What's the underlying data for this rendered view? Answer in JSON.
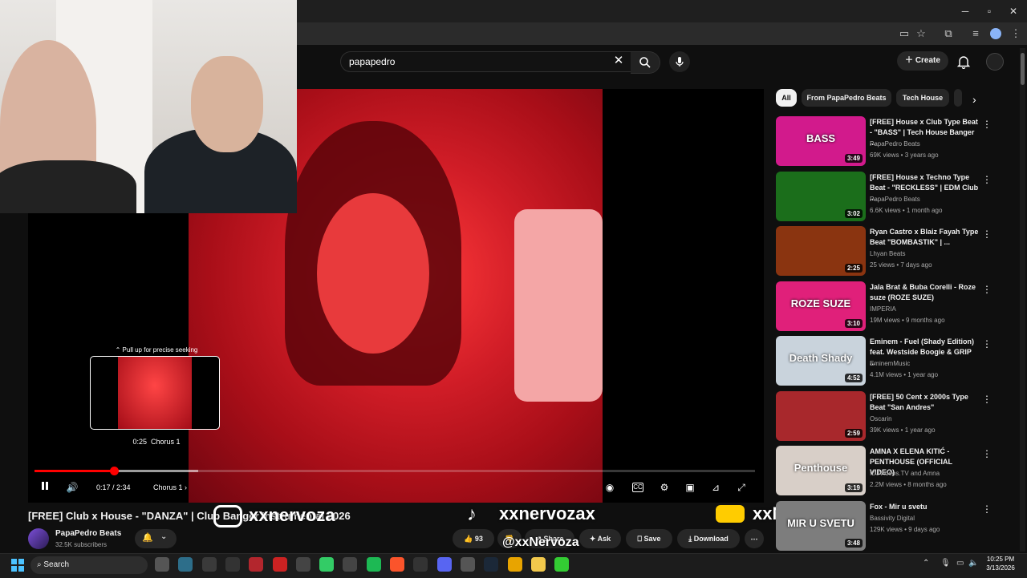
{
  "browser": {
    "minimize": "─",
    "maximize": "▫",
    "close": "✕"
  },
  "youtube": {
    "search": {
      "query": "papapedro"
    },
    "create_label": "Create"
  },
  "player": {
    "hint": "Pull up for precise seeking",
    "preview_time": "0:25",
    "preview_chapter": "Chorus 1",
    "time": "0:17 / 2:34",
    "chapter": "Chorus 1",
    "progress_fraction": 0.11
  },
  "video": {
    "title": "[FREE] Club x House - \"DANZA\" | Club Banger Instrumental 2026",
    "channel": "PapaPedro Beats",
    "subscribers": "32.5K subscribers",
    "likes": "93",
    "share_label": "Share",
    "ask_label": "Ask",
    "save_label": "Save",
    "download_label": "Download"
  },
  "overlays": {
    "instagram": "xxnervoza",
    "tiktok": "xxnervozax",
    "youtube": "xxNervozax",
    "handle": "@xxNervoza"
  },
  "chips": [
    "All",
    "From PapaPedro Beats",
    "Tech House"
  ],
  "recommendations": [
    {
      "title": "[FREE] House x Club Type Beat - \"BASS\" | Tech House Banger ...",
      "channel": "PapaPedro Beats",
      "meta": "69K views • 3 years ago",
      "duration": "3:49",
      "thumb_text": "BASS",
      "color": "#d21a8c"
    },
    {
      "title": "[FREE] House x Techno Type Beat - \"RECKLESS\" | EDM Club ...",
      "channel": "PapaPedro Beats",
      "meta": "6.6K views • 1 month ago",
      "duration": "3:02",
      "thumb_text": "",
      "color": "#1b6e1b"
    },
    {
      "title": "Ryan Castro x Blaiz Fayah Type Beat \"BOMBASTIK\" | ...",
      "channel": "Lhyan Beats",
      "meta": "25 views • 7 days ago",
      "duration": "2:25",
      "thumb_text": "",
      "color": "#8a3410"
    },
    {
      "title": "Jala Brat & Buba Corelli - Roze suze (ROZE SUZE)",
      "channel": "IMPERIA",
      "meta": "19M views • 9 months ago",
      "duration": "3:10",
      "thumb_text": "ROZE SUZE",
      "color": "#e0207a"
    },
    {
      "title": "Eminem - Fuel (Shady Edition) feat. Westside Boogie & GRIP ...",
      "channel": "EminemMusic",
      "meta": "4.1M views • 1 year ago",
      "duration": "4:52",
      "thumb_text": "Death Shady",
      "color": "#c9d3dc"
    },
    {
      "title": "[FREE] 50 Cent x 2000s Type Beat \"San Andres\"",
      "channel": "Oscarin",
      "meta": "39K views • 1 year ago",
      "duration": "2:59",
      "thumb_text": "",
      "color": "#a8282c"
    },
    {
      "title": "AMNA X ELENA KITIĆ - PENTHOUSE (OFFICIAL VIDEO)",
      "channel": "IDJVideos.TV and Amna",
      "meta": "2.2M views • 8 months ago",
      "duration": "3:19",
      "thumb_text": "Penthouse",
      "color": "#d8cfc8"
    },
    {
      "title": "Fox - Mir u svetu",
      "channel": "Bassivity Digital",
      "meta": "129K views • 9 days ago",
      "duration": "3:48",
      "thumb_text": "MIR U SVETU",
      "color": "#7d7d7d"
    }
  ],
  "taskbar": {
    "search_label": "Search",
    "time": "10:25 PM",
    "date": "3/13/2026"
  }
}
